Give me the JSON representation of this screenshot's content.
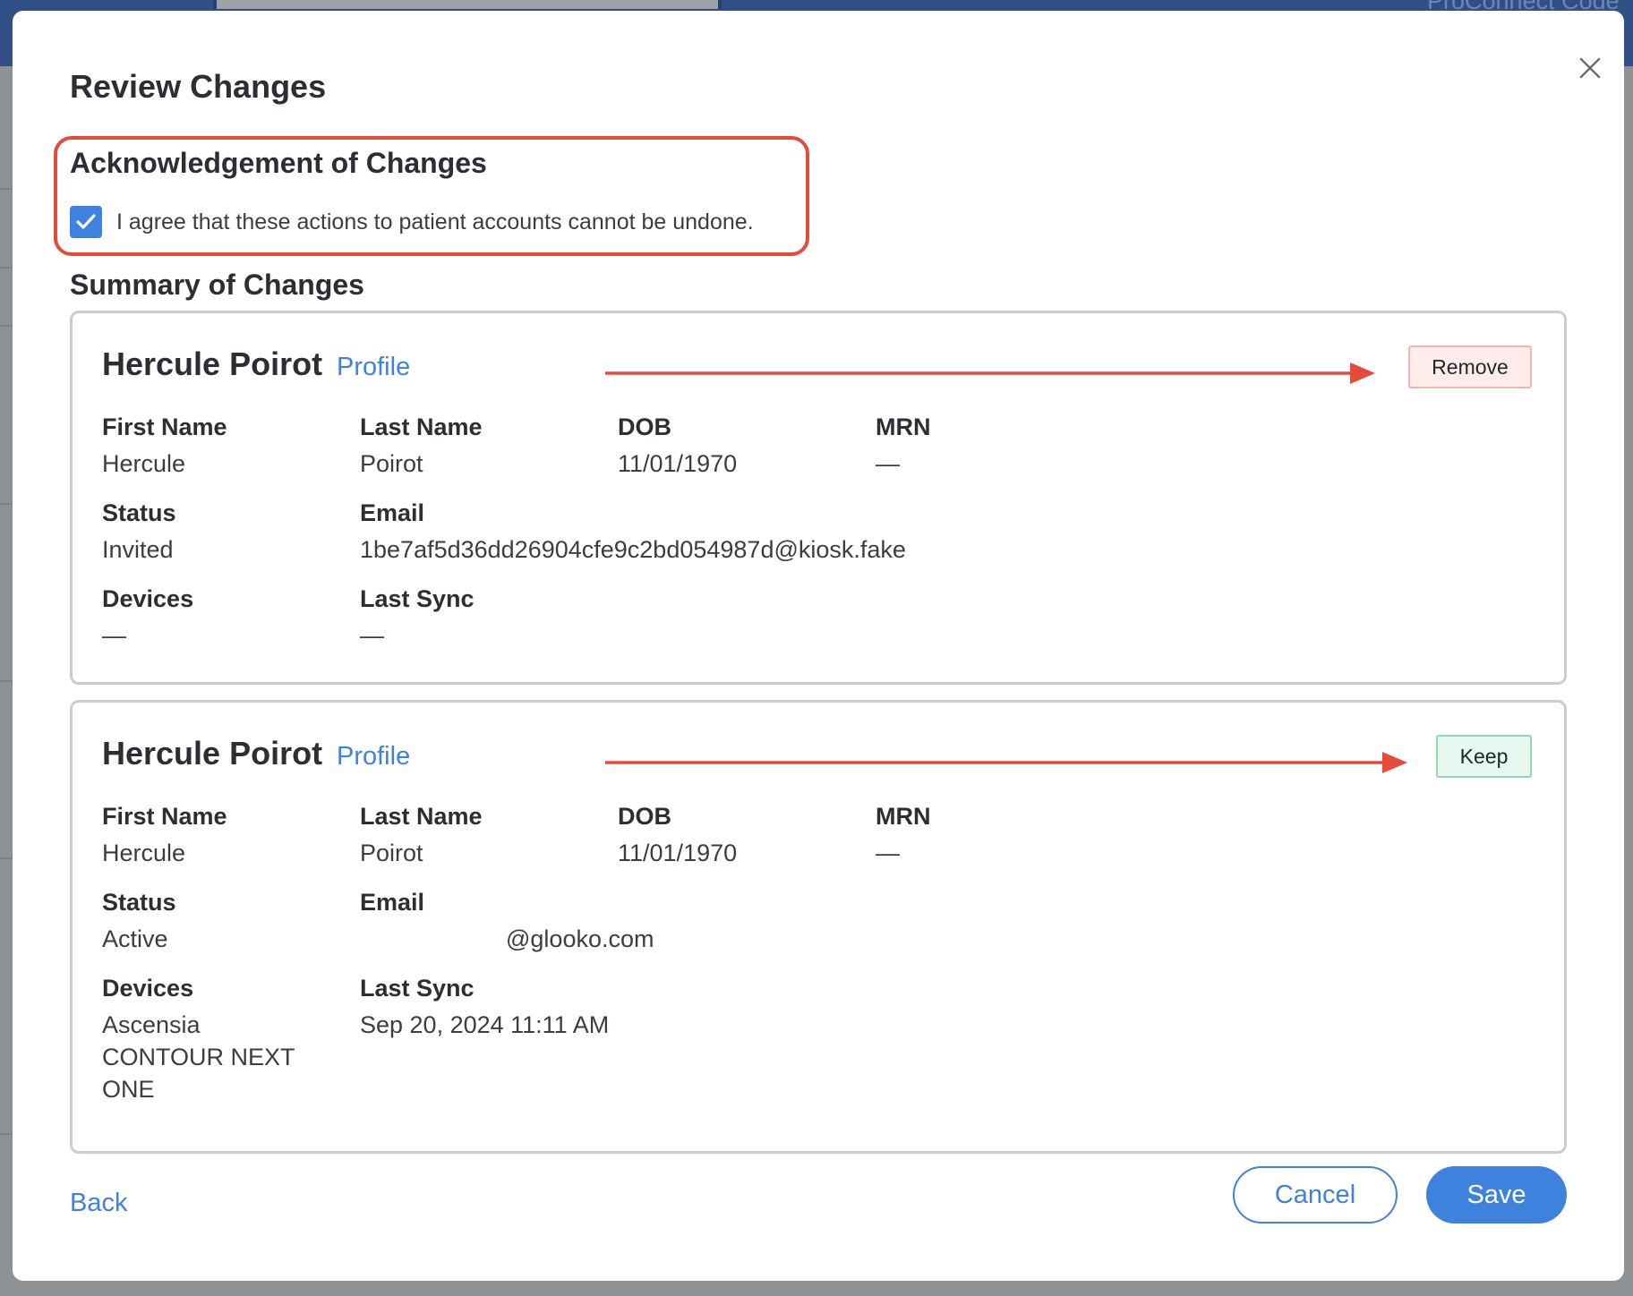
{
  "background": {
    "brand_text": "ProConnect Code"
  },
  "modal": {
    "title": "Review Changes",
    "close_icon": "close-icon"
  },
  "acknowledgement": {
    "title": "Acknowledgement of Changes",
    "checked": true,
    "text": "I agree that these actions to patient accounts cannot be undone."
  },
  "summary": {
    "title": "Summary of Changes",
    "field_labels": {
      "first_name": "First Name",
      "last_name": "Last Name",
      "dob": "DOB",
      "mrn": "MRN",
      "status": "Status",
      "email": "Email",
      "devices": "Devices",
      "last_sync": "Last Sync"
    },
    "patients": [
      {
        "name": "Hercule Poirot",
        "profile_link": "Profile",
        "action_label": "Remove",
        "first_name": "Hercule",
        "last_name": "Poirot",
        "dob": "11/01/1970",
        "mrn": "—",
        "status": "Invited",
        "email": "1be7af5d36dd26904cfe9c2bd054987d@kiosk.fake",
        "devices": "—",
        "last_sync": "—"
      },
      {
        "name": "Hercule Poirot",
        "profile_link": "Profile",
        "action_label": "Keep",
        "first_name": "Hercule",
        "last_name": "Poirot",
        "dob": "11/01/1970",
        "mrn": "—",
        "status": "Active",
        "email": "@glooko.com",
        "devices": "Ascensia CONTOUR NEXT ONE",
        "last_sync": "Sep 20, 2024 11:11 AM"
      }
    ]
  },
  "footer": {
    "back_label": "Back",
    "cancel_label": "Cancel",
    "save_label": "Save"
  },
  "colors": {
    "accent": "#3f82de",
    "annotation_red": "#e54a3a",
    "remove_bg": "#fdecea",
    "keep_bg": "#e5f7ee"
  }
}
